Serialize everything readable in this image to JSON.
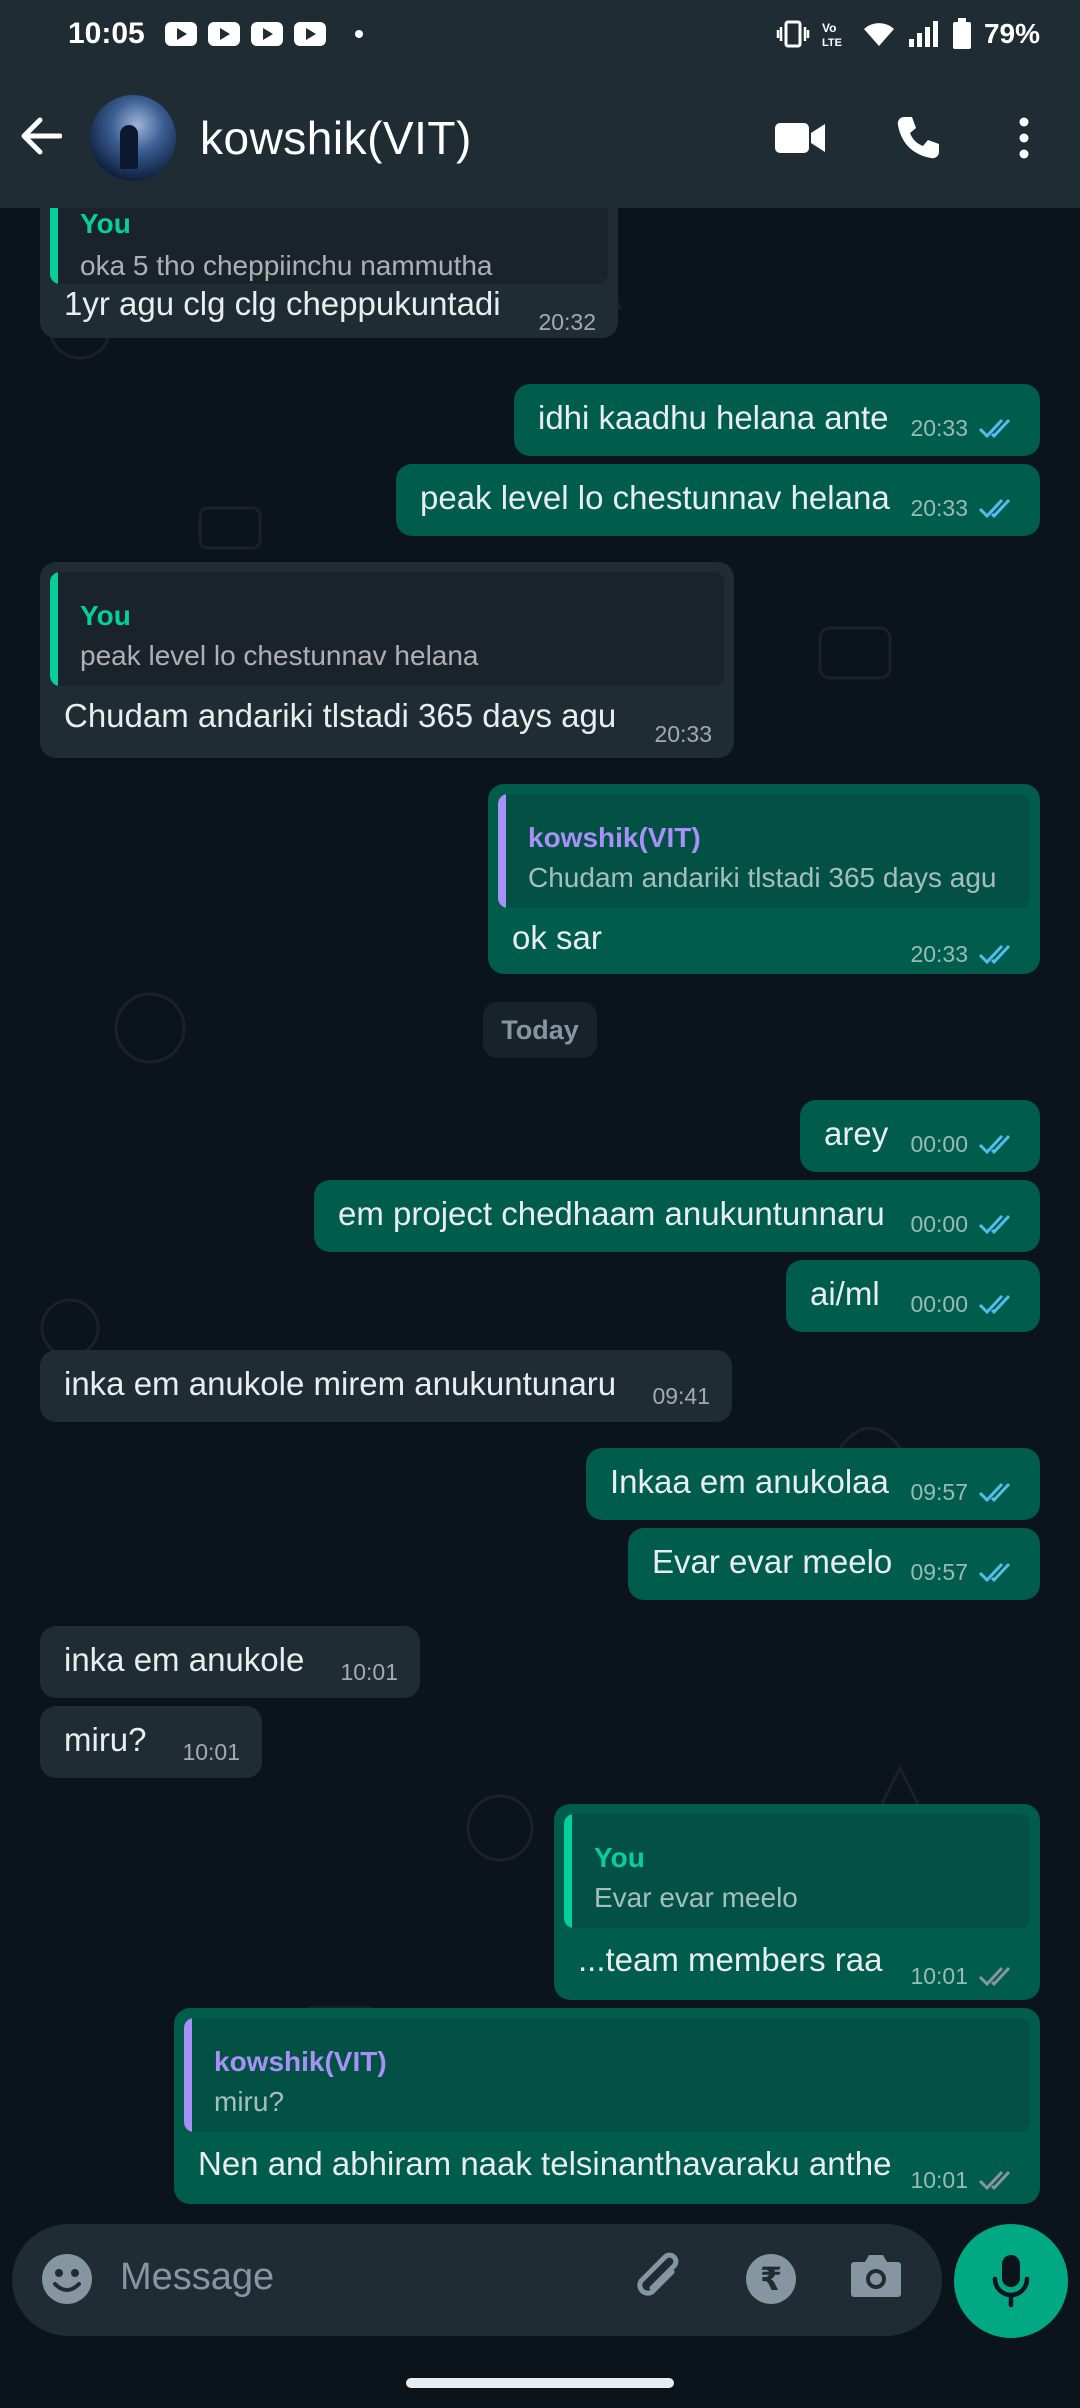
{
  "status_bar": {
    "time": "10:05",
    "battery": "79%"
  },
  "header": {
    "contact_name": "kowshik(VIT)"
  },
  "chat": {
    "day_separator": "Today",
    "messages": [
      {
        "dir": "in",
        "quote_author": "You",
        "quote_text": "oka 5 tho cheppiinchu nammutha",
        "text": "1yr agu clg clg cheppukuntadi",
        "time": "20:32"
      },
      {
        "dir": "out",
        "text": "idhi kaadhu helana ante",
        "time": "20:33"
      },
      {
        "dir": "out",
        "text": "peak level lo chestunnav helana",
        "time": "20:33"
      },
      {
        "dir": "in",
        "quote_author": "You",
        "quote_text": "peak level lo chestunnav helana",
        "text": "Chudam andariki tlstadi 365 days agu",
        "time": "20:33"
      },
      {
        "dir": "out",
        "quote_author": "kowshik(VIT)",
        "quote_text": "Chudam andariki tlstadi 365 days agu",
        "text": "ok sar",
        "time": "20:33"
      },
      {
        "dir": "out",
        "text": "arey",
        "time": "00:00"
      },
      {
        "dir": "out",
        "text": "em project chedhaam anukuntunnaru",
        "time": "00:00"
      },
      {
        "dir": "out",
        "text": "ai/ml",
        "time": "00:00"
      },
      {
        "dir": "in",
        "text": "inka em anukole mirem anukuntunaru",
        "time": "09:41"
      },
      {
        "dir": "out",
        "text": "Inkaa em anukolaa",
        "time": "09:57"
      },
      {
        "dir": "out",
        "text": "Evar evar meelo",
        "time": "09:57"
      },
      {
        "dir": "in",
        "text": "inka em anukole",
        "time": "10:01"
      },
      {
        "dir": "in",
        "text": "miru?",
        "time": "10:01"
      },
      {
        "dir": "out",
        "quote_author": "You",
        "quote_text": "Evar evar meelo",
        "text": "...team members raa",
        "time": "10:01"
      },
      {
        "dir": "out",
        "quote_author": "kowshik(VIT)",
        "quote_text": "miru?",
        "text": "Nen and abhiram naak telsinanthavaraku anthe",
        "time": "10:01"
      }
    ]
  },
  "composer": {
    "placeholder": "Message"
  },
  "colors": {
    "incoming_bubble": "#202c33",
    "outgoing_bubble": "#005c4b",
    "accent": "#00a884",
    "read_tick": "#53bdeb",
    "quote_you": "#06cf9c",
    "quote_contact": "#a791f6"
  }
}
